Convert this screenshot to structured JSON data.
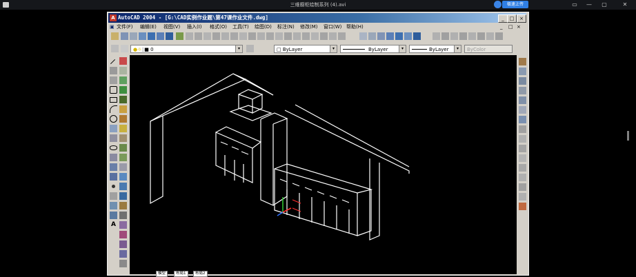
{
  "player": {
    "title": "三维橱柜绘制系列 (4).avi",
    "upload_label": "极速上传",
    "controls": [
      "▭",
      "—",
      "▢",
      "✕"
    ]
  },
  "cad": {
    "title": "AutoCAD 2004 - [G:\\CAD实例作业题\\第47课作业文件.dwg]",
    "app_icon": "A",
    "window_buttons": [
      "_",
      "□",
      "×"
    ],
    "menu_icon": "▣",
    "menus": [
      "文件(F)",
      "编辑(E)",
      "视图(V)",
      "插入(I)",
      "格式(O)",
      "工具(T)",
      "绘图(D)",
      "标注(N)",
      "修改(M)",
      "窗口(W)",
      "帮助(H)"
    ],
    "doc_buttons": [
      "_",
      "□",
      "×"
    ],
    "layer_value": "0",
    "color_value": "ByLayer",
    "linetype_value": "ByLayer",
    "lineweight_value": "ByLayer",
    "plotstyle_value": "ByColor",
    "dropdown_arrow": "▾",
    "tabs": {
      "nav": [
        "◂",
        "◂",
        "▸",
        "▸"
      ],
      "model": "模型",
      "layout1": "布局1",
      "layout2": "布局2"
    }
  },
  "colors": {
    "titlebar": "#0a246a",
    "canvas": "#000000",
    "chrome": "#d4d0c8"
  }
}
